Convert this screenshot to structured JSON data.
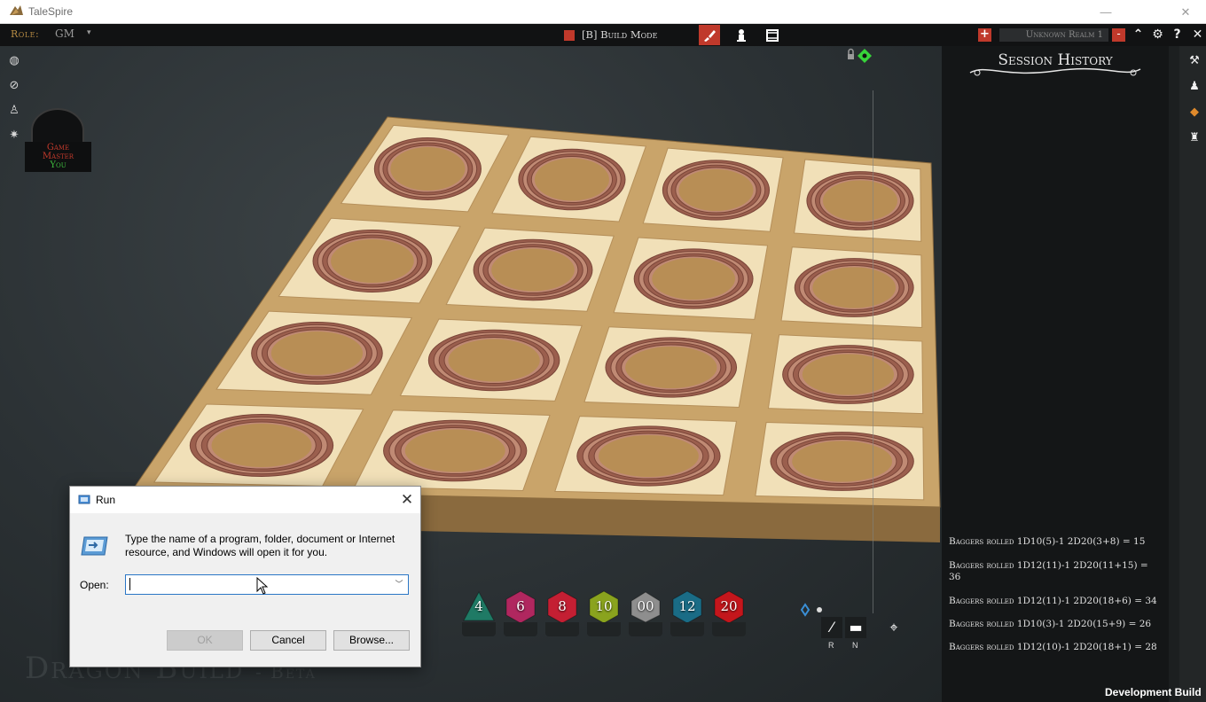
{
  "window": {
    "title": "TaleSpire",
    "minimize": "—",
    "close": "✕"
  },
  "topbar": {
    "role_label": "Role:",
    "role_value": "GM",
    "role_caret": "▾",
    "build_mode_label": "[B] Build Mode",
    "realm_name": "Unknown Realm 1",
    "realm_minus": "-",
    "add_label": "+",
    "colors": {
      "accent": "#c0392b",
      "bg": "#111213"
    }
  },
  "left_tools": [
    "globe-icon",
    "eye-off-icon",
    "player-icon",
    "light-icon"
  ],
  "gm_badge": {
    "line1": "Game",
    "line2": "Master",
    "line3": "You"
  },
  "dice": [
    {
      "label": "4",
      "color": "#1f7a65"
    },
    {
      "label": "6",
      "color": "#b0275f"
    },
    {
      "label": "8",
      "color": "#c41f33"
    },
    {
      "label": "10",
      "color": "#8aa31e"
    },
    {
      "label": "00",
      "color": "#8e8e8e"
    },
    {
      "label": "12",
      "color": "#1a6c86"
    },
    {
      "label": "20",
      "color": "#c4161c"
    }
  ],
  "measure": {
    "ruler_key": "R",
    "line_key": "N"
  },
  "watermark": {
    "title": "Dragon Build",
    "suffix": "- Beta"
  },
  "history": {
    "title": "Session History",
    "entries": [
      "Baggers rolled 1D10(5)-1 2D20(3+8) = 15",
      "Baggers rolled 1D12(11)-1 2D20(11+15) = 36",
      "Baggers rolled 1D12(11)-1 2D20(18+6) = 34",
      "Baggers rolled 1D10(3)-1 2D20(15+9) = 26",
      "Baggers rolled 1D12(10)-1 2D20(18+1) = 28"
    ]
  },
  "footer": {
    "dev_build": "Development Build"
  },
  "run_dialog": {
    "title": "Run",
    "description": "Type the name of a program, folder, document or Internet resource, and Windows will open it for you.",
    "open_label": "Open:",
    "input_value": "",
    "ok_label": "OK",
    "cancel_label": "Cancel",
    "browse_label": "Browse..."
  }
}
